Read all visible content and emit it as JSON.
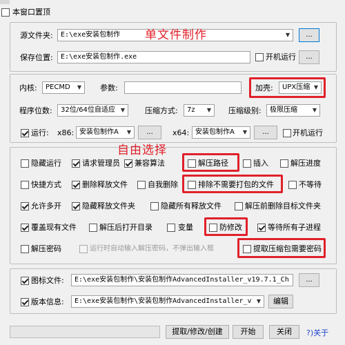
{
  "top": {
    "pin_label": "本窗口置顶"
  },
  "source": {
    "label": "源文件夹:",
    "value": "E:\\exe安装包制作",
    "browse": "...",
    "annotation": "单文件制作"
  },
  "save": {
    "label": "保存位置:",
    "value": "E:\\exe安装包制作.exe",
    "autostart_label": "开机运行",
    "browse": "..."
  },
  "kernel": {
    "label": "内核:",
    "value": "PECMD",
    "param_label": "参数:",
    "param_value": "",
    "shell_label": "加壳:",
    "shell_value": "UPX压缩"
  },
  "bits": {
    "label": "程序位数:",
    "value": "32位/64位自适应",
    "method_label": "压缩方式:",
    "method_value": "7z",
    "level_label": "压缩级别:",
    "level_value": "极限压缩"
  },
  "run": {
    "label": "运行:",
    "x86_label": "x86:",
    "x86_value": "安装包制作A",
    "x86_browse": "...",
    "x64_label": "x64:",
    "x64_value": "安装包制作A",
    "x64_browse": "...",
    "boot_label": "开机运行"
  },
  "options": {
    "annotation": "自由选择",
    "row1": [
      "隐藏运行",
      "请求管理员",
      "兼容算法",
      "解压路径",
      "插入",
      "解压进度"
    ],
    "row2": [
      "快捷方式",
      "删除释放文件",
      "自我删除",
      "排除不需要打包的文件",
      "不等待"
    ],
    "row3": [
      "允许多开",
      "隐藏释放文件夹",
      "隐藏所有释放文件",
      "解压前删除目标文件夹"
    ],
    "row4": [
      "覆盖现有文件",
      "解压后打开目录",
      "变量",
      "防修改",
      "等待所有子进程"
    ],
    "row5": [
      "解压密码",
      "运行时自动输入解压密码，不弹出输入框",
      "提取压缩包需要密码"
    ]
  },
  "icon": {
    "label": "图标文件:",
    "value": "E:\\exe安装包制作\\安装包制作AdvancedInstaller_v19.7.1_Ch",
    "browse": "..."
  },
  "version": {
    "label": "版本信息:",
    "value": "E:\\exe安装包制作\\安装包制作AdvancedInstaller_v19",
    "edit": "编辑"
  },
  "bottom": {
    "extract": "提取/修改/创建",
    "start": "开始",
    "close": "关闭",
    "about": "?)关于"
  },
  "icons": {
    "dropdown": "▼",
    "check": "check-mark"
  },
  "colors": {
    "annotation": "#e0202a",
    "focus": "#0078d7",
    "link": "#1a3fd0"
  }
}
